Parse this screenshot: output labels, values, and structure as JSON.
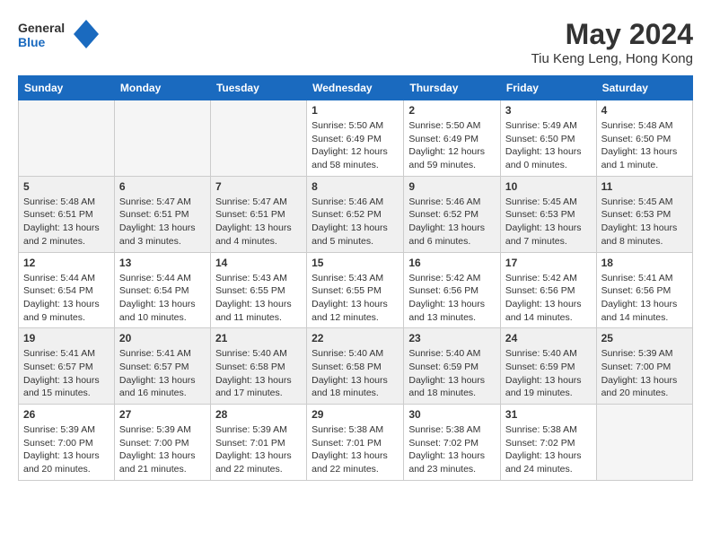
{
  "header": {
    "logo_line1": "General",
    "logo_line2": "Blue",
    "month": "May 2024",
    "location": "Tiu Keng Leng, Hong Kong"
  },
  "weekdays": [
    "Sunday",
    "Monday",
    "Tuesday",
    "Wednesday",
    "Thursday",
    "Friday",
    "Saturday"
  ],
  "rows": [
    [
      {
        "day": "",
        "text": ""
      },
      {
        "day": "",
        "text": ""
      },
      {
        "day": "",
        "text": ""
      },
      {
        "day": "1",
        "text": "Sunrise: 5:50 AM\nSunset: 6:49 PM\nDaylight: 12 hours and 58 minutes."
      },
      {
        "day": "2",
        "text": "Sunrise: 5:50 AM\nSunset: 6:49 PM\nDaylight: 12 hours and 59 minutes."
      },
      {
        "day": "3",
        "text": "Sunrise: 5:49 AM\nSunset: 6:50 PM\nDaylight: 13 hours and 0 minutes."
      },
      {
        "day": "4",
        "text": "Sunrise: 5:48 AM\nSunset: 6:50 PM\nDaylight: 13 hours and 1 minute."
      }
    ],
    [
      {
        "day": "5",
        "text": "Sunrise: 5:48 AM\nSunset: 6:51 PM\nDaylight: 13 hours and 2 minutes."
      },
      {
        "day": "6",
        "text": "Sunrise: 5:47 AM\nSunset: 6:51 PM\nDaylight: 13 hours and 3 minutes."
      },
      {
        "day": "7",
        "text": "Sunrise: 5:47 AM\nSunset: 6:51 PM\nDaylight: 13 hours and 4 minutes."
      },
      {
        "day": "8",
        "text": "Sunrise: 5:46 AM\nSunset: 6:52 PM\nDaylight: 13 hours and 5 minutes."
      },
      {
        "day": "9",
        "text": "Sunrise: 5:46 AM\nSunset: 6:52 PM\nDaylight: 13 hours and 6 minutes."
      },
      {
        "day": "10",
        "text": "Sunrise: 5:45 AM\nSunset: 6:53 PM\nDaylight: 13 hours and 7 minutes."
      },
      {
        "day": "11",
        "text": "Sunrise: 5:45 AM\nSunset: 6:53 PM\nDaylight: 13 hours and 8 minutes."
      }
    ],
    [
      {
        "day": "12",
        "text": "Sunrise: 5:44 AM\nSunset: 6:54 PM\nDaylight: 13 hours and 9 minutes."
      },
      {
        "day": "13",
        "text": "Sunrise: 5:44 AM\nSunset: 6:54 PM\nDaylight: 13 hours and 10 minutes."
      },
      {
        "day": "14",
        "text": "Sunrise: 5:43 AM\nSunset: 6:55 PM\nDaylight: 13 hours and 11 minutes."
      },
      {
        "day": "15",
        "text": "Sunrise: 5:43 AM\nSunset: 6:55 PM\nDaylight: 13 hours and 12 minutes."
      },
      {
        "day": "16",
        "text": "Sunrise: 5:42 AM\nSunset: 6:56 PM\nDaylight: 13 hours and 13 minutes."
      },
      {
        "day": "17",
        "text": "Sunrise: 5:42 AM\nSunset: 6:56 PM\nDaylight: 13 hours and 14 minutes."
      },
      {
        "day": "18",
        "text": "Sunrise: 5:41 AM\nSunset: 6:56 PM\nDaylight: 13 hours and 14 minutes."
      }
    ],
    [
      {
        "day": "19",
        "text": "Sunrise: 5:41 AM\nSunset: 6:57 PM\nDaylight: 13 hours and 15 minutes."
      },
      {
        "day": "20",
        "text": "Sunrise: 5:41 AM\nSunset: 6:57 PM\nDaylight: 13 hours and 16 minutes."
      },
      {
        "day": "21",
        "text": "Sunrise: 5:40 AM\nSunset: 6:58 PM\nDaylight: 13 hours and 17 minutes."
      },
      {
        "day": "22",
        "text": "Sunrise: 5:40 AM\nSunset: 6:58 PM\nDaylight: 13 hours and 18 minutes."
      },
      {
        "day": "23",
        "text": "Sunrise: 5:40 AM\nSunset: 6:59 PM\nDaylight: 13 hours and 18 minutes."
      },
      {
        "day": "24",
        "text": "Sunrise: 5:40 AM\nSunset: 6:59 PM\nDaylight: 13 hours and 19 minutes."
      },
      {
        "day": "25",
        "text": "Sunrise: 5:39 AM\nSunset: 7:00 PM\nDaylight: 13 hours and 20 minutes."
      }
    ],
    [
      {
        "day": "26",
        "text": "Sunrise: 5:39 AM\nSunset: 7:00 PM\nDaylight: 13 hours and 20 minutes."
      },
      {
        "day": "27",
        "text": "Sunrise: 5:39 AM\nSunset: 7:00 PM\nDaylight: 13 hours and 21 minutes."
      },
      {
        "day": "28",
        "text": "Sunrise: 5:39 AM\nSunset: 7:01 PM\nDaylight: 13 hours and 22 minutes."
      },
      {
        "day": "29",
        "text": "Sunrise: 5:38 AM\nSunset: 7:01 PM\nDaylight: 13 hours and 22 minutes."
      },
      {
        "day": "30",
        "text": "Sunrise: 5:38 AM\nSunset: 7:02 PM\nDaylight: 13 hours and 23 minutes."
      },
      {
        "day": "31",
        "text": "Sunrise: 5:38 AM\nSunset: 7:02 PM\nDaylight: 13 hours and 24 minutes."
      },
      {
        "day": "",
        "text": ""
      }
    ]
  ]
}
